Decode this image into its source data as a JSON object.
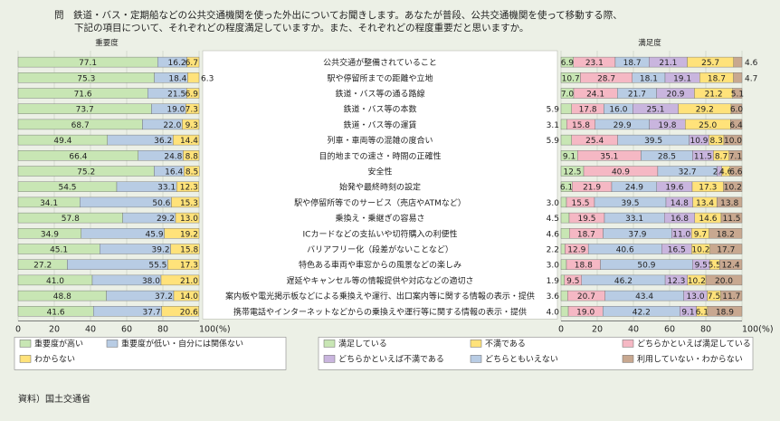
{
  "question": {
    "line1": "問　鉄道・バス・定期船などの公共交通機関を使った外出についてお聞きします。あなたが普段、公共交通機関を使って移動する際、",
    "line2": "下記の項目について、それぞれどの程度満足していますか。また、それぞれどの程度重要だと思いますか。"
  },
  "source": "資料）国土交通省",
  "colors": {
    "background": "#ecf0e6",
    "importance": [
      "#c8e6b4",
      "#b8cce4",
      "#ffe27a"
    ],
    "satisfaction": [
      "#c8e6b4",
      "#f5b8c4",
      "#b8cce4",
      "#c9b5de",
      "#ffe27a",
      "#c8a890"
    ]
  },
  "chart_data": [
    {
      "type": "bar",
      "orientation": "horizontal",
      "stacked": true,
      "title": "重要度",
      "xlim": [
        0,
        100
      ],
      "x_ticks": [
        "0",
        "20",
        "40",
        "60",
        "80",
        "100(%)"
      ],
      "series": [
        {
          "name": "重要度が高い",
          "values": [
            77.1,
            75.3,
            71.6,
            73.7,
            68.7,
            49.4,
            66.4,
            75.2,
            54.5,
            34.1,
            57.8,
            34.9,
            45.1,
            27.2,
            41.0,
            48.8,
            41.6
          ]
        },
        {
          "name": "重要度が低い・自分には関係ない",
          "values": [
            16.2,
            18.4,
            21.5,
            19.0,
            22.0,
            36.2,
            24.8,
            16.4,
            33.1,
            50.6,
            29.2,
            45.9,
            39.2,
            55.5,
            38.0,
            37.2,
            37.7
          ]
        },
        {
          "name": "わからない",
          "values": [
            6.7,
            6.3,
            6.9,
            7.3,
            9.3,
            14.4,
            8.8,
            8.5,
            12.3,
            15.3,
            13.0,
            19.2,
            15.8,
            17.3,
            21.0,
            14.0,
            20.6
          ]
        }
      ]
    },
    {
      "type": "bar",
      "orientation": "horizontal",
      "stacked": true,
      "title": "満足度",
      "xlim": [
        0,
        100
      ],
      "x_ticks": [
        "0",
        "20",
        "40",
        "60",
        "80",
        "100(%)"
      ],
      "series": [
        {
          "name": "満足している",
          "values": [
            6.9,
            10.7,
            7.0,
            5.9,
            3.1,
            5.9,
            9.1,
            12.5,
            6.1,
            3.0,
            4.5,
            4.6,
            2.2,
            3.0,
            1.9,
            3.6,
            4.0
          ]
        },
        {
          "name": "どちらかといえば満足している",
          "values": [
            23.1,
            28.7,
            24.1,
            17.8,
            15.8,
            25.4,
            35.1,
            40.9,
            21.9,
            15.5,
            19.5,
            18.7,
            12.9,
            18.8,
            9.5,
            20.7,
            19.0
          ]
        },
        {
          "name": "どちらともいえない",
          "values": [
            18.7,
            18.1,
            21.7,
            16.0,
            29.9,
            39.5,
            28.5,
            32.7,
            24.9,
            39.5,
            33.1,
            37.9,
            40.6,
            50.9,
            46.2,
            43.4,
            42.2
          ]
        },
        {
          "name": "どちらかといえば不満である",
          "values": [
            21.1,
            19.1,
            20.9,
            25.1,
            19.8,
            10.9,
            11.5,
            2.6,
            19.6,
            14.8,
            16.8,
            11.0,
            16.5,
            9.5,
            12.3,
            13.0,
            9.1
          ]
        },
        {
          "name": "不満である",
          "values": [
            25.7,
            18.7,
            21.2,
            29.2,
            25.0,
            8.3,
            8.7,
            4.6,
            17.3,
            13.4,
            14.6,
            9.7,
            10.2,
            5.5,
            10.2,
            7.5,
            6.1
          ]
        },
        {
          "name": "利用していない・わからない",
          "values": [
            4.6,
            4.7,
            5.1,
            6.0,
            6.4,
            10.0,
            7.1,
            6.6,
            10.2,
            13.8,
            11.5,
            18.2,
            17.7,
            12.4,
            20.0,
            11.7,
            18.9
          ]
        }
      ],
      "labels": [
        [
          "6.9",
          "23.1",
          "18.7",
          "21.1",
          "25.7",
          "4.6"
        ],
        [
          "10.7",
          "28.7",
          "18.1",
          "19.1",
          "18.7",
          "4.7"
        ],
        [
          "7.0",
          "24.1",
          "21.7",
          "20.9",
          "21.2",
          "5.1"
        ],
        [
          "5.9",
          "17.8",
          "16.0",
          "25.1",
          "29.2",
          "6.0"
        ],
        [
          "3.1",
          "15.8",
          "29.9",
          "19.8",
          "25.0",
          "6.4"
        ],
        [
          "5.9",
          "25.4",
          "39.5",
          "10.9",
          "8.3",
          "10.0"
        ],
        [
          "9.1",
          "35.1",
          "28.5",
          "11.5",
          "8.7",
          "7.1"
        ],
        [
          "12.5",
          "40.9",
          "32.7",
          "2.6",
          "4.6",
          "6.6"
        ],
        [
          "6.1",
          "21.9",
          "24.9",
          "19.6",
          "17.3",
          "10.2"
        ],
        [
          "3.0",
          "15.5",
          "39.5",
          "14.8",
          "13.4",
          "13.8"
        ],
        [
          "4.5",
          "19.5",
          "33.1",
          "16.8",
          "14.6",
          "11.5"
        ],
        [
          "4.6",
          "18.7",
          "37.9",
          "11.0",
          "9.7",
          "18.2"
        ],
        [
          "2.2",
          "12.9",
          "40.6",
          "16.5",
          "10.2",
          "17.7"
        ],
        [
          "3.0",
          "18.8",
          "50.9",
          "9.5",
          "5.5",
          "12.4"
        ],
        [
          "1.9",
          "9.5",
          "46.2",
          "12.3",
          "10.2",
          "20.0"
        ],
        [
          "3.6",
          "20.7",
          "43.4",
          "13.0",
          "7.5",
          "11.7"
        ],
        [
          "4.0",
          "19.0",
          "42.2",
          "9.1",
          "6.1",
          "18.9"
        ]
      ]
    }
  ],
  "items": [
    "公共交通が整備されていること",
    "駅や停留所までの距離や立地",
    "鉄道・バス等の通る路線",
    "鉄道・バス等の本数",
    "鉄道・バス等の運賃",
    "列車・車両等の混雑の度合い",
    "目的地までの速さ・時間の正確性",
    "安全性",
    "始発や最終時刻の設定",
    "駅や停留所等でのサービス（売店やATMなど）",
    "乗換え・乗継ぎの容易さ",
    "ICカードなどの支払いや切符購入の利便性",
    "バリアフリー化（段差がないことなど）",
    "特色ある車両や車窓からの風景などの楽しみ",
    "遅延やキャンセル等の情報提供や対応などの適切さ",
    "案内板や電光掲示板などによる乗換えや運行、出口案内等に関する情報の表示・提供",
    "携帯電話やインターネットなどからの乗換えや運行等に関する情報の表示・提供"
  ],
  "legend_importance": [
    "重要度が高い",
    "重要度が低い・自分には関係ない",
    "わからない"
  ],
  "legend_satisfaction": [
    "満足している",
    "どちらかといえば満足している",
    "どちらともいえない",
    "どちらかといえば不満である",
    "不満である",
    "利用していない・わからない"
  ]
}
